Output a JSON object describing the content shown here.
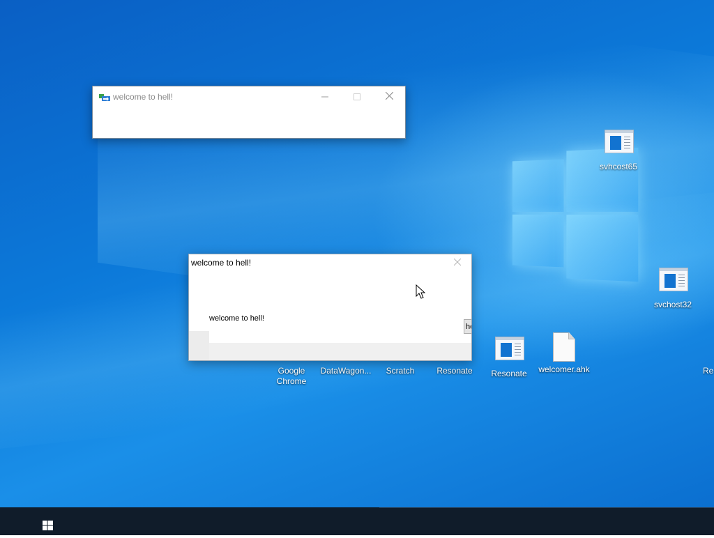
{
  "windows": {
    "back_window": {
      "title": "welcome to hell!",
      "icon": "app-window-icon",
      "controls": [
        "minimize-icon",
        "maximize-icon",
        "close-icon"
      ]
    },
    "front_dialog": {
      "title": "welcome to hell!",
      "message": "welcome to hell!",
      "button_stub": "he"
    }
  },
  "desktop_icons": [
    {
      "label": "svhcost65",
      "icon": "app-window-icon"
    },
    {
      "label": "svchost32",
      "icon": "app-window-icon"
    },
    {
      "label": "Google Chrome",
      "icon": "chrome-icon"
    },
    {
      "label": "DataWagon...",
      "icon": "app-icon"
    },
    {
      "label": "Scratch",
      "icon": "scratch-icon"
    },
    {
      "label": "Resonate",
      "icon": "app-icon"
    },
    {
      "label": "Resonate",
      "icon": "app-window-icon"
    },
    {
      "label": "welcomer.ahk",
      "icon": "file-icon"
    },
    {
      "label": "Re",
      "icon": "app-icon"
    }
  ],
  "taskbar": {
    "start_icon": "windows-start-icon"
  },
  "colors": {
    "desktop_blue": "#0c79d9",
    "taskbar": "#101c2a",
    "window_border": "#7a8a9a"
  }
}
